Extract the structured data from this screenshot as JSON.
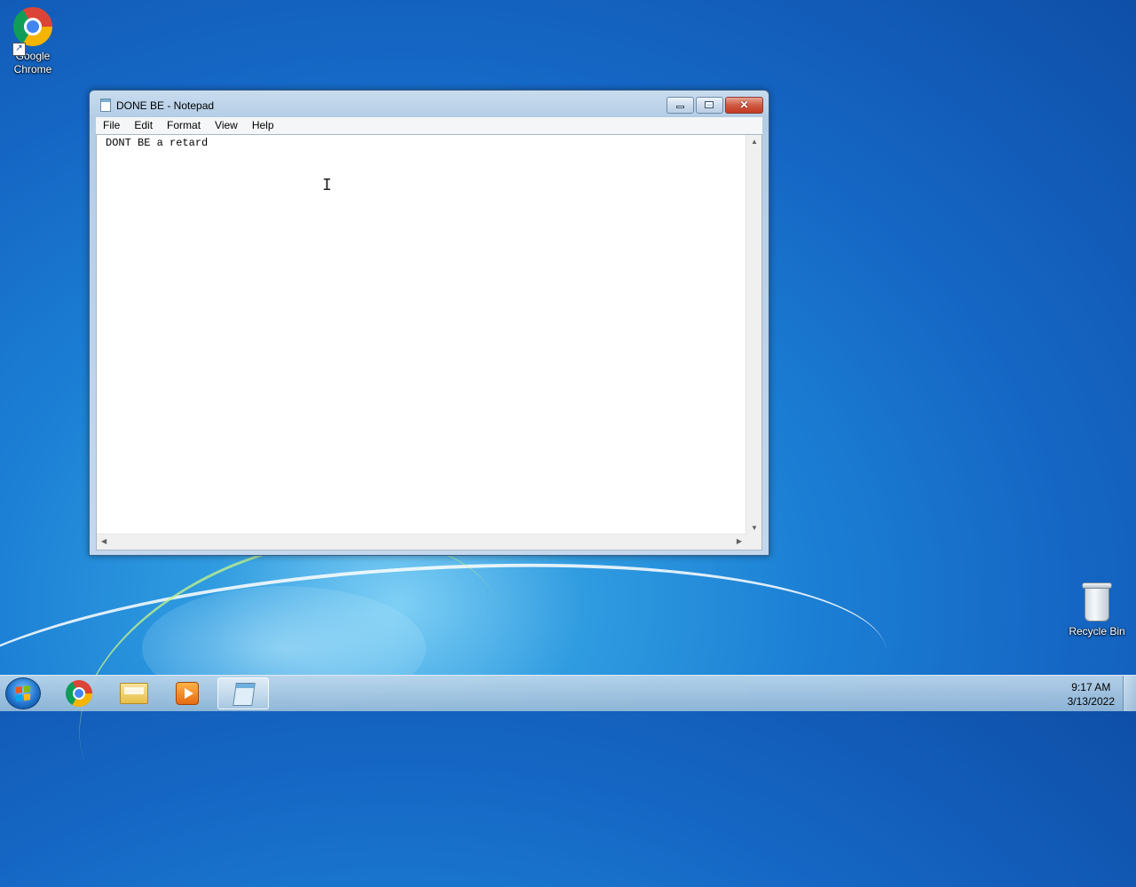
{
  "desktop": {
    "icons": [
      {
        "label": "Google Chrome",
        "icon": "chrome-icon"
      },
      {
        "label": "Recycle Bin",
        "icon": "recycle-bin-icon"
      }
    ]
  },
  "window": {
    "title": "DONE BE - Notepad",
    "app_icon": "notepad-icon",
    "menu": [
      "File",
      "Edit",
      "Format",
      "View",
      "Help"
    ],
    "content": "DONT BE a retard",
    "caption_buttons": {
      "minimize": "minimize",
      "maximize": "maximize",
      "close": "✕"
    }
  },
  "taskbar": {
    "start_icon": "windows-start-icon",
    "pinned": [
      "chrome-icon",
      "file-explorer-icon",
      "media-player-icon",
      "notepad-icon"
    ],
    "active": "notepad-icon",
    "clock": {
      "time": "9:17 AM",
      "date": "3/13/2022"
    }
  },
  "colors": {
    "desktop": "#1b7fd4",
    "close_button": "#c23a22"
  }
}
